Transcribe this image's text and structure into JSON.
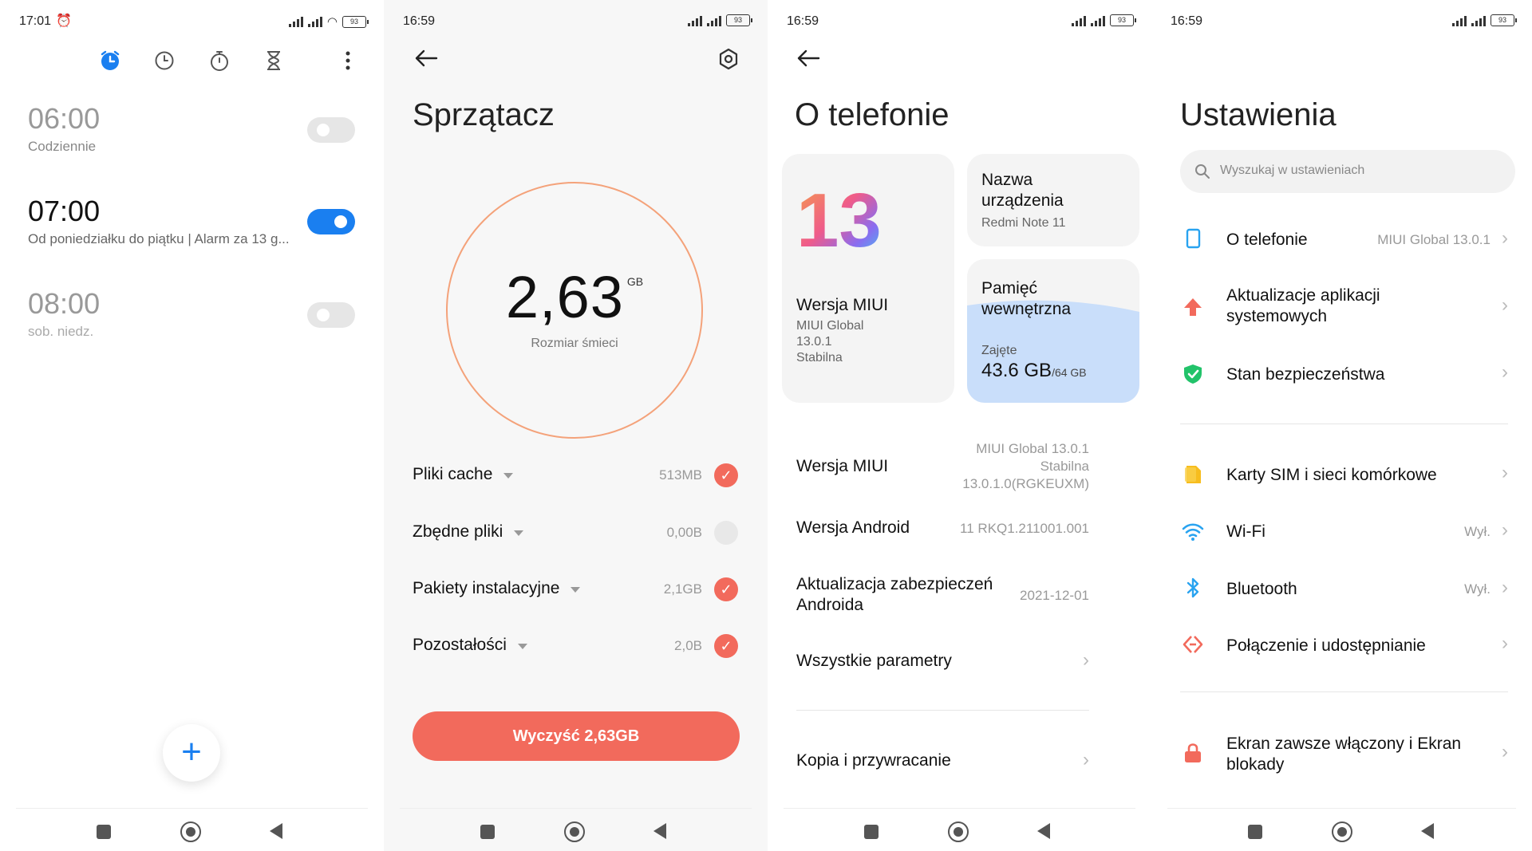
{
  "panel1": {
    "status_time": "17:01",
    "battery": "93",
    "tabs": [
      "alarm-icon",
      "clock-icon",
      "stopwatch-icon",
      "timer-icon",
      "more-icon"
    ],
    "alarms": [
      {
        "time": "06:00",
        "sub": "Codziennie",
        "on": false
      },
      {
        "time": "07:00",
        "sub": "Od poniedziałku do piątku | Alarm za 13 g...",
        "on": true
      },
      {
        "time": "08:00",
        "sub": "sob. niedz.",
        "on": false
      }
    ],
    "fab_label": "+"
  },
  "panel2": {
    "status_time": "16:59",
    "battery": "93",
    "title": "Sprzątacz",
    "total_value": "2,63",
    "total_unit": "GB",
    "total_label": "Rozmiar śmieci",
    "items": [
      {
        "label": "Pliki cache",
        "size": "513MB",
        "checked": true
      },
      {
        "label": "Zbędne pliki",
        "size": "0,00B",
        "checked": false
      },
      {
        "label": "Pakiety instalacyjne",
        "size": "2,1GB",
        "checked": true
      },
      {
        "label": "Pozostałości",
        "size": "2,0B",
        "checked": true
      }
    ],
    "button_label": "Wyczyść 2,63GB",
    "accent": "#f26a5c"
  },
  "panel3": {
    "status_time": "16:59",
    "battery": "93",
    "title": "O telefonie",
    "logo_text": "13",
    "miui_card": {
      "label": "Wersja MIUI",
      "l1": "MIUI Global",
      "l2": "13.0.1",
      "l3": "Stabilna"
    },
    "device_card": {
      "label1": "Nazwa",
      "label2": "urządzenia",
      "value": "Redmi Note 11"
    },
    "storage_card": {
      "label1": "Pamięć",
      "label2": "wewnętrzna",
      "used_label": "Zajęte",
      "used": "43.6 GB",
      "total": "/64 GB",
      "fill_fraction": 0.68
    },
    "rows": [
      {
        "label": "Wersja MIUI",
        "v1": "MIUI Global 13.0.1",
        "v2": "Stabilna",
        "v3": "13.0.1.0(RGKEUXM)"
      },
      {
        "label": "Wersja Android",
        "v1": "11 RKQ1.211001.001"
      },
      {
        "label1": "Aktualizacja zabezpieczeń",
        "label2": "Androida",
        "v1": "2021-12-01"
      },
      {
        "label": "Wszystkie parametry"
      },
      {
        "label": "Kopia i przywracanie"
      }
    ]
  },
  "panel4": {
    "status_time": "16:59",
    "battery": "93",
    "title": "Ustawienia",
    "search_placeholder": "Wyszukaj w ustawieniach",
    "items": [
      {
        "label": "O telefonie",
        "value": "MIUI Global 13.0.1",
        "icon": "phone-icon"
      },
      {
        "label1": "Aktualizacje aplikacji",
        "label2": "systemowych",
        "icon": "update-arrow-icon"
      },
      {
        "label": "Stan bezpieczeństwa",
        "icon": "shield-icon"
      },
      {
        "label": "Karty SIM i sieci komórkowe",
        "icon": "sim-icon"
      },
      {
        "label": "Wi-Fi",
        "value": "Wył.",
        "icon": "wifi-icon"
      },
      {
        "label": "Bluetooth",
        "value": "Wył.",
        "icon": "bluetooth-icon"
      },
      {
        "label": "Połączenie i udostępnianie",
        "icon": "share-icon"
      },
      {
        "label1": "Ekran zawsze włączony i Ekran",
        "label2": "blokady",
        "icon": "lock-icon"
      }
    ]
  }
}
